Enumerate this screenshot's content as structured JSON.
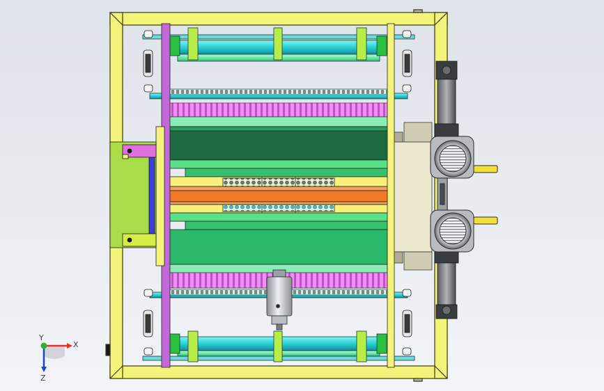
{
  "viewport": {
    "background_top": "#dfe3ea",
    "background_bottom": "#f2f4f7"
  },
  "axes_triad": {
    "x_label": "X",
    "y_label": "Y",
    "z_label": "Z",
    "x_color": "#e8302c",
    "y_color": "#30b030",
    "z_color": "#2040d0"
  },
  "colors": {
    "frame": "#f4f47a",
    "frame_edge": "#3a3a10",
    "side_plate": "#c06ad8",
    "roller_cyan": "#2ad0d8",
    "roller_dark": "#18a0a8",
    "roller_green_light": "#7ff0b0",
    "clamp_green": "#a8e84a",
    "comb_pink": "#e070e0",
    "drum_dark": "#1a6a44",
    "drum_mid": "#2ab86a",
    "band_green": "#5be08a",
    "band_yellow": "#f6f07a",
    "band_orange": "#f07a28",
    "band_salmon": "#f0a060",
    "perforation": "#3ad0d0",
    "housing": "#ece8cf",
    "motor_gray": "#8a8e92",
    "motor_dark": "#3a3d40",
    "shaft_yellow": "#f2e03a",
    "cylinder_silver": "#c8cdd4",
    "bracket_green": "#b8e84a",
    "bracket_blue": "#3a40d8"
  }
}
